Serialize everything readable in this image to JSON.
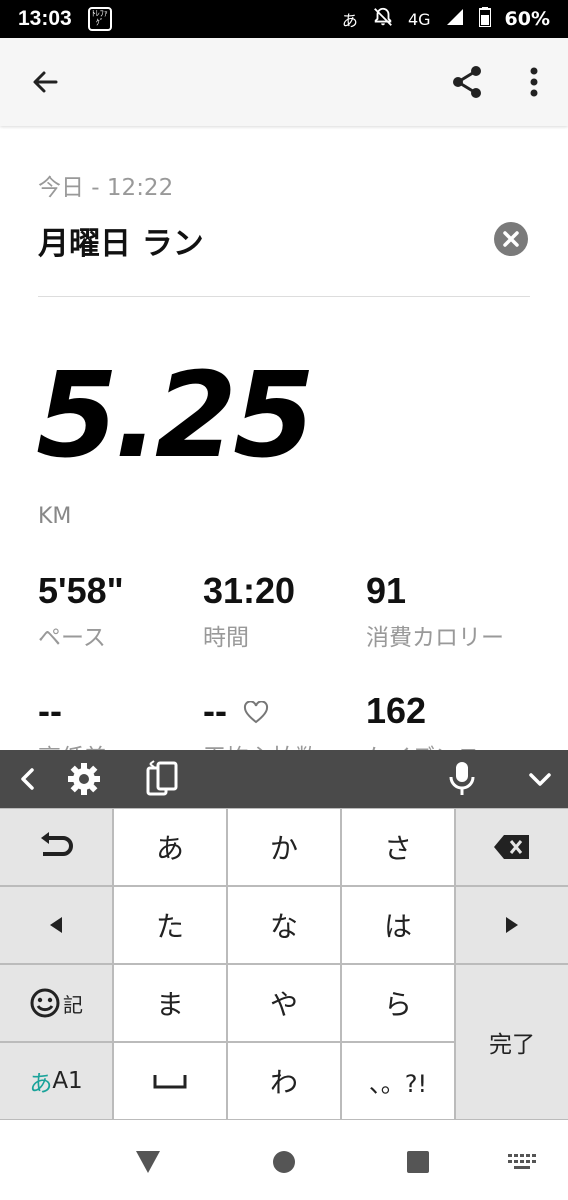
{
  "status_bar": {
    "time": "13:03",
    "app_icon_text": "ﾄﾚﾌｧｸﾞ",
    "ime_indicator": "あ",
    "network": "4G",
    "battery": "60%"
  },
  "workout": {
    "date": "今日 - 12:22",
    "title": "月曜日 ラン",
    "distance": "5.25",
    "unit": "KM",
    "stats": [
      {
        "value": "5'58\"",
        "label": "ペース"
      },
      {
        "value": "31:20",
        "label": "時間"
      },
      {
        "value": "91",
        "label": "消費カロリー"
      },
      {
        "value": "--",
        "label": "高低差"
      },
      {
        "value": "--",
        "label": "平均心拍数"
      },
      {
        "value": "162",
        "label": "ケイデンス"
      }
    ]
  },
  "keyboard": {
    "keys": {
      "a": "あ",
      "ka": "か",
      "sa": "さ",
      "ta": "た",
      "na": "な",
      "ha": "は",
      "ma": "ま",
      "ya": "や",
      "ra": "ら",
      "space": "␣",
      "wa": "わ",
      "punct": "、。?!",
      "emoji_label": "記",
      "mode_hira": "あ",
      "mode_alpha": "A1",
      "done": "完了"
    }
  },
  "colors": {
    "status_bar_bg": "#000000",
    "keyboard_toolbar_bg": "#4a4a4a",
    "mode_accent": "#1aa39a"
  }
}
